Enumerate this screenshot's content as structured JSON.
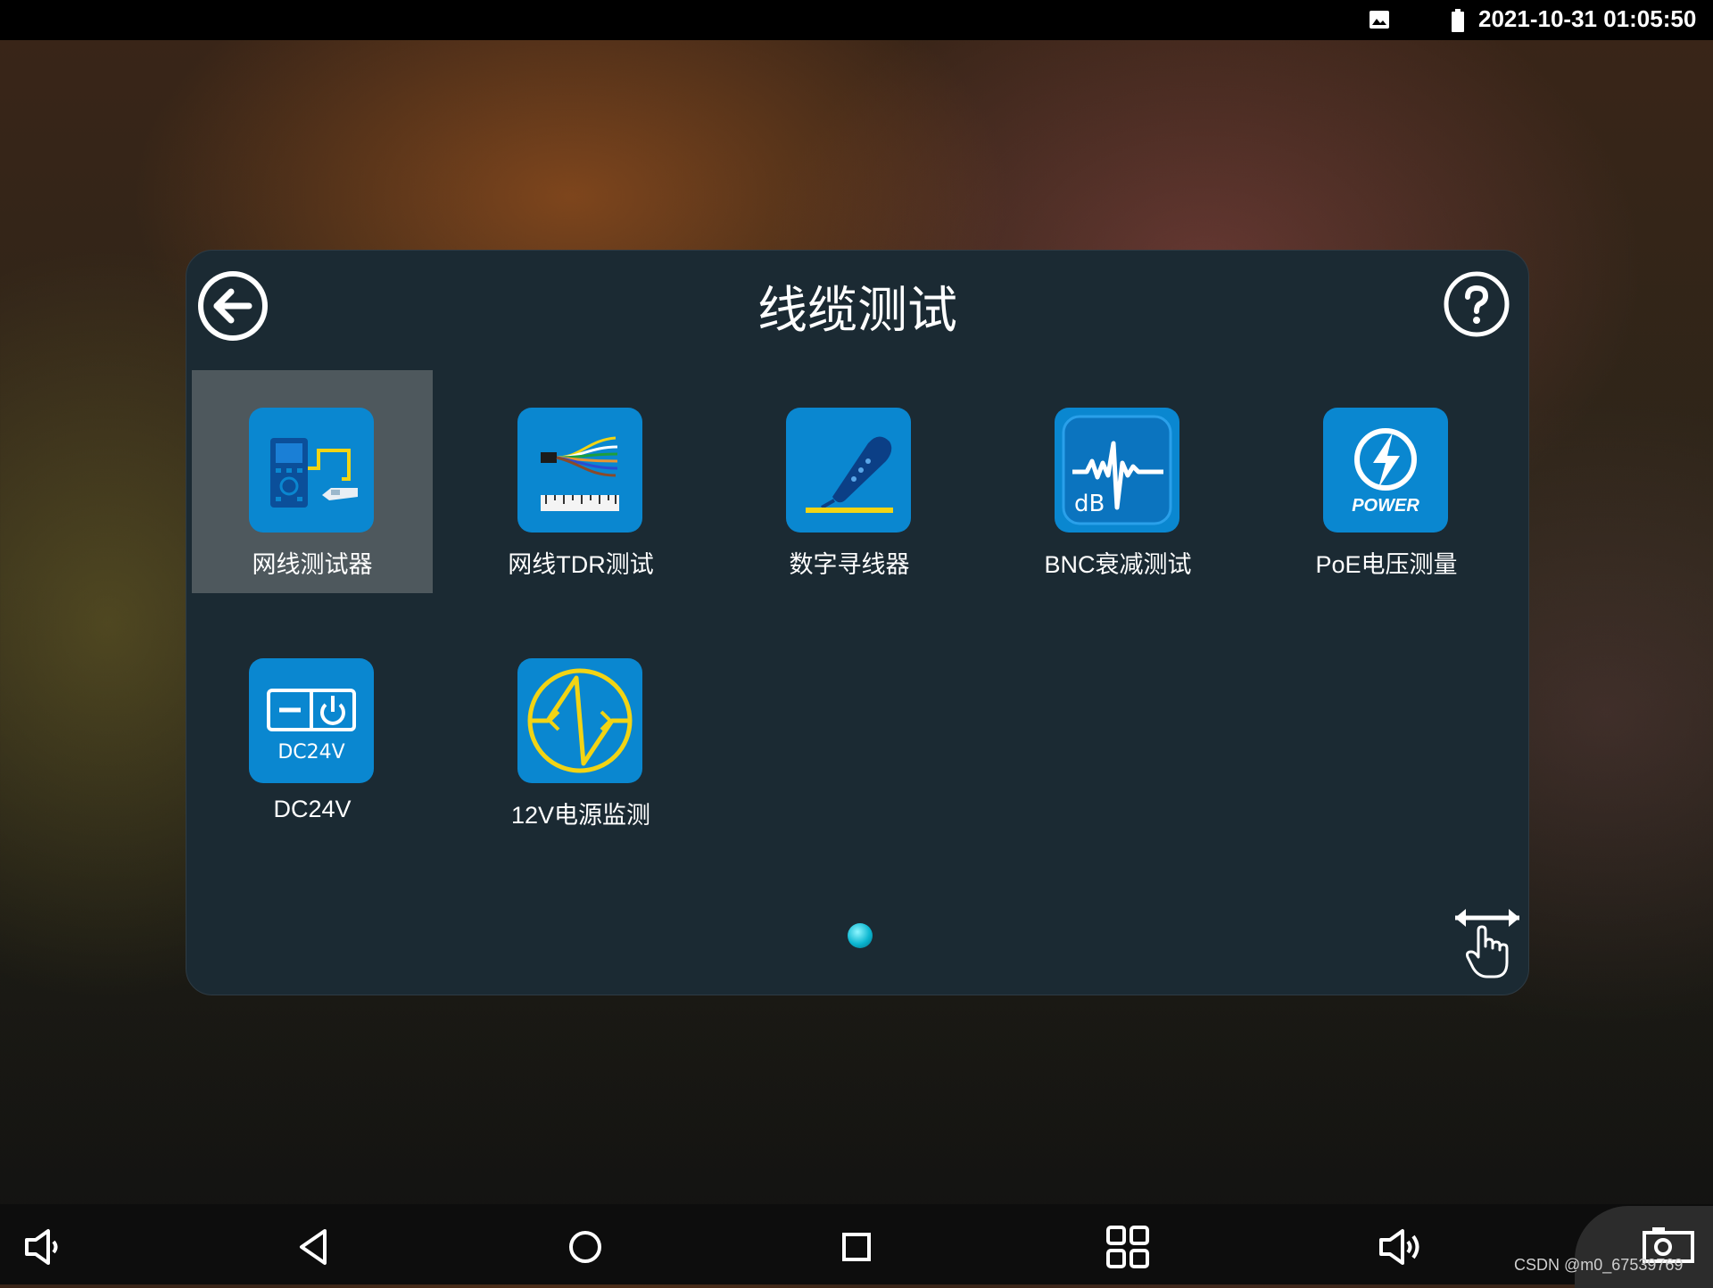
{
  "status_bar": {
    "datetime": "2021-10-31 01:05:50",
    "icons": [
      "image-icon",
      "battery-icon"
    ]
  },
  "panel": {
    "title": "线缆测试",
    "back_icon": "arrow-left-circle-icon",
    "help_icon": "question-circle-icon",
    "apps": [
      {
        "label": "网线测试器",
        "icon": "cable-tester-icon",
        "selected": true
      },
      {
        "label": "网线TDR测试",
        "icon": "tdr-cable-icon"
      },
      {
        "label": "数字寻线器",
        "icon": "wire-tracer-icon"
      },
      {
        "label": "BNC衰减测试",
        "icon": "db-waveform-icon",
        "icon_text": "dB"
      },
      {
        "label": "PoE电压测量",
        "icon": "power-bolt-icon",
        "icon_text": "POWER"
      },
      {
        "label": "DC24V",
        "icon": "dc24v-power-icon",
        "icon_text": "DC24V"
      },
      {
        "label": "12V电源监测",
        "icon": "waveform-circle-icon"
      }
    ],
    "pager": {
      "pages": 1,
      "current": 1
    },
    "swipe_hint_icon": "swipe-hand-icon"
  },
  "nav_bar": {
    "buttons": [
      "volume-down-icon",
      "back-icon",
      "home-icon",
      "recents-icon",
      "apps-grid-icon",
      "volume-up-icon",
      "screenshot-icon"
    ]
  },
  "watermark": "CSDN @m0_67539769",
  "colors": {
    "panel_bg": "#1b2a33",
    "icon_bg": "#0a87d0",
    "selected_tile": "#4e585d",
    "accent_yellow": "#f2d414"
  }
}
